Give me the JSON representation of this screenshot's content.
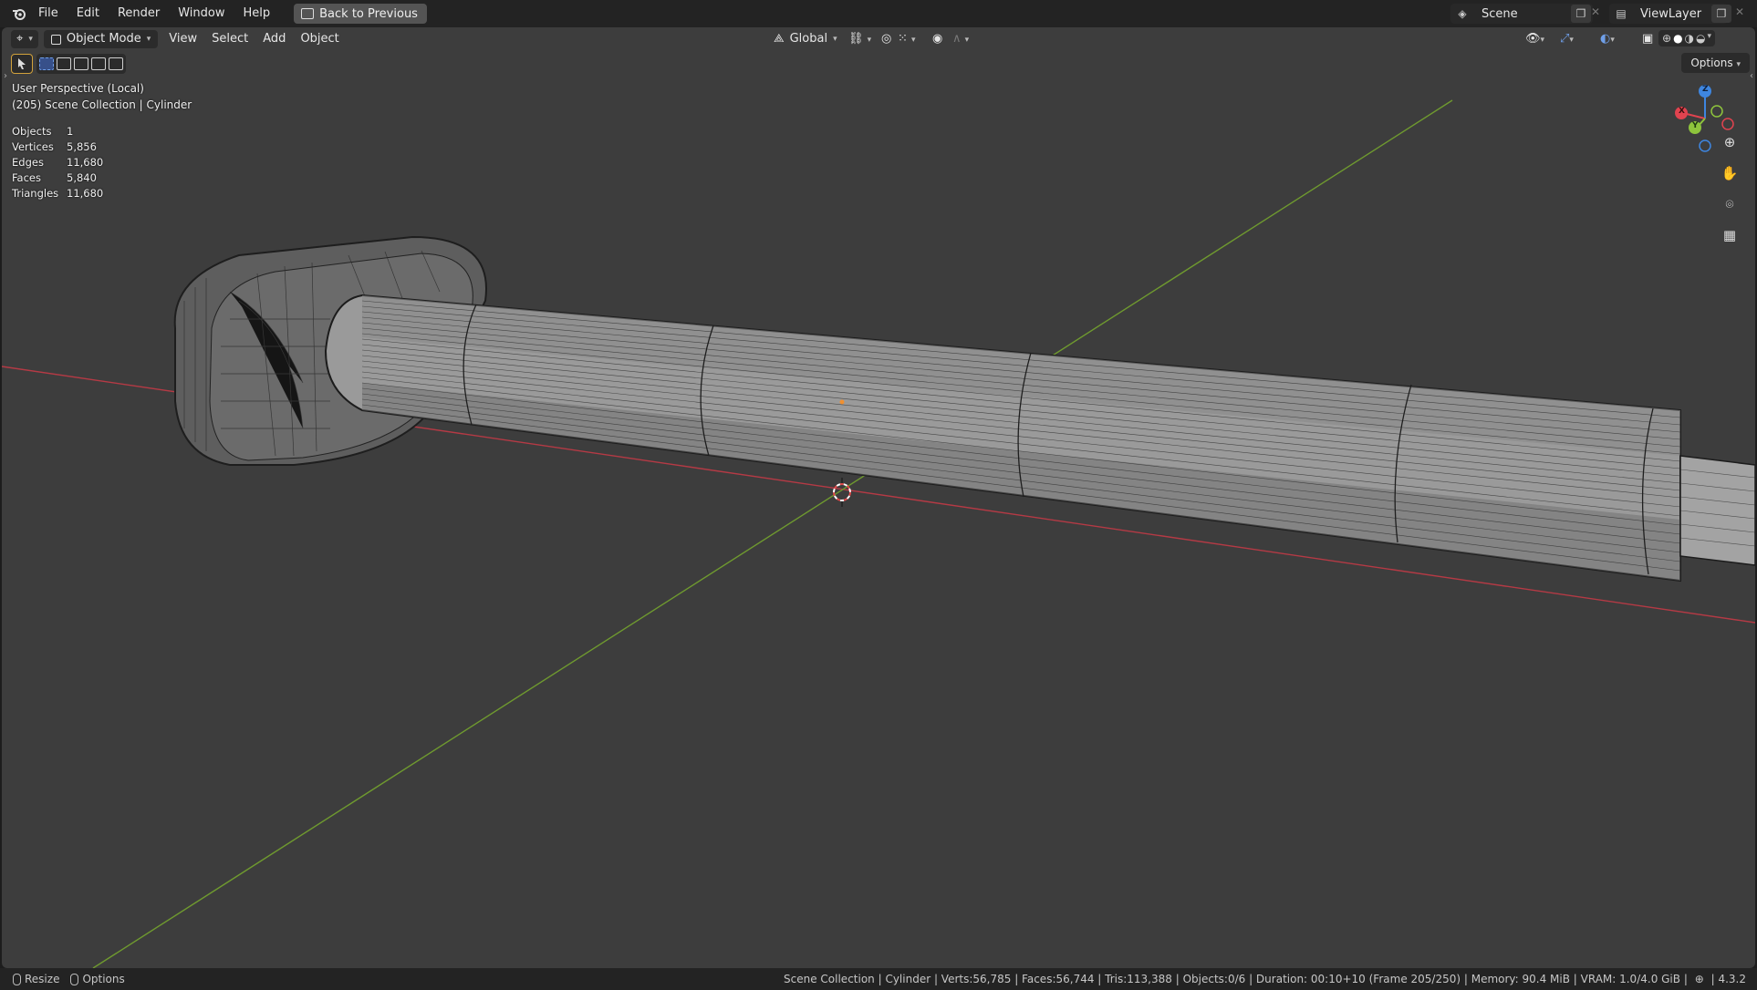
{
  "topbar": {
    "menus": [
      "File",
      "Edit",
      "Render",
      "Window",
      "Help"
    ],
    "back_button": "Back to Previous",
    "scene_name": "Scene",
    "view_layer": "ViewLayer"
  },
  "viewport_header": {
    "mode": "Object Mode",
    "menus": [
      "View",
      "Select",
      "Add",
      "Object"
    ],
    "transform_orientation": "Global",
    "options_label": "Options"
  },
  "overlay": {
    "perspective": "User Perspective (Local)",
    "collection": "(205) Scene Collection | Cylinder"
  },
  "stats": [
    {
      "label": "Objects",
      "value": "1"
    },
    {
      "label": "Vertices",
      "value": "5,856"
    },
    {
      "label": "Edges",
      "value": "11,680"
    },
    {
      "label": "Faces",
      "value": "5,840"
    },
    {
      "label": "Triangles",
      "value": "11,680"
    }
  ],
  "gizmo": {
    "x": "X",
    "y": "Y",
    "z": "Z"
  },
  "statusbar": {
    "left_items": [
      "Resize",
      "Options"
    ],
    "info": "Scene Collection | Cylinder | Verts:56,785 | Faces:56,744 | Tris:113,388 | Objects:0/6 | Duration: 00:10+10 (Frame 205/250) | Memory: 90.4 MiB | VRAM: 1.0/4.0 GiB | ",
    "version": "4.3.2"
  },
  "colors": {
    "viewport_bg": "#3d3d3d",
    "x_axis": "#b53a45",
    "y_axis": "#6f9a2f",
    "gizmo_x": "#e0434f",
    "gizmo_y": "#8ec43c",
    "gizmo_z": "#3e86e0"
  }
}
